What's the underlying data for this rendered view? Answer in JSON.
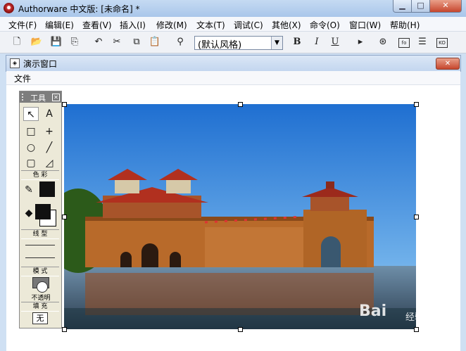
{
  "window": {
    "title": "Authorware 中文版: [未命名] *"
  },
  "menubar": [
    {
      "label": "文件(F)"
    },
    {
      "label": "编辑(E)"
    },
    {
      "label": "查看(V)"
    },
    {
      "label": "插入(I)"
    },
    {
      "label": "修改(M)"
    },
    {
      "label": "文本(T)"
    },
    {
      "label": "调试(C)"
    },
    {
      "label": "其他(X)"
    },
    {
      "label": "命令(O)"
    },
    {
      "label": "窗口(W)"
    },
    {
      "label": "帮助(H)"
    }
  ],
  "toolbar": {
    "style_value": "(默认风格)",
    "bold": "B",
    "italic": "I",
    "underline": "U",
    "fn_label": "fo",
    "ko_label": "KO"
  },
  "presentation_window": {
    "title": "演示窗口",
    "menu_file": "文件"
  },
  "palette": {
    "title": "工具",
    "color_label": "色 彩",
    "line_label": "线 型",
    "mode_label": "模 式",
    "mode_value": "不透明",
    "fill_label": "填 充",
    "fill_value": "无"
  },
  "image": {
    "alt": "Illustration of an ancient Chinese city gate with red-roofed towers reflected in water"
  },
  "watermark": {
    "text": "Bai",
    "sub": "经验"
  }
}
